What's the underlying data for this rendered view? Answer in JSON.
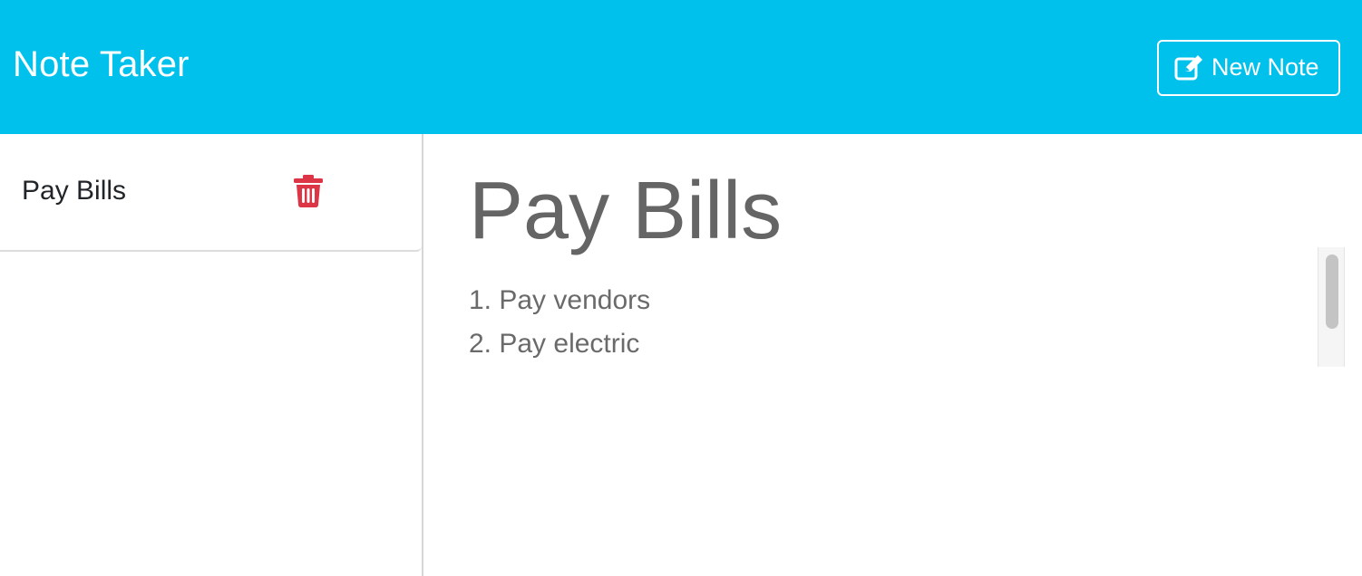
{
  "header": {
    "brand": "Note Taker",
    "new_note_label": "New Note",
    "new_note_icon": "edit-icon",
    "background_color": "#00c1ec"
  },
  "sidebar": {
    "items": [
      {
        "title": "Pay Bills",
        "delete_icon": "trash-icon",
        "delete_color": "#dc3545"
      }
    ]
  },
  "editor": {
    "title": "Pay Bills",
    "body_lines": [
      "1. Pay vendors",
      "2. Pay electric"
    ]
  }
}
